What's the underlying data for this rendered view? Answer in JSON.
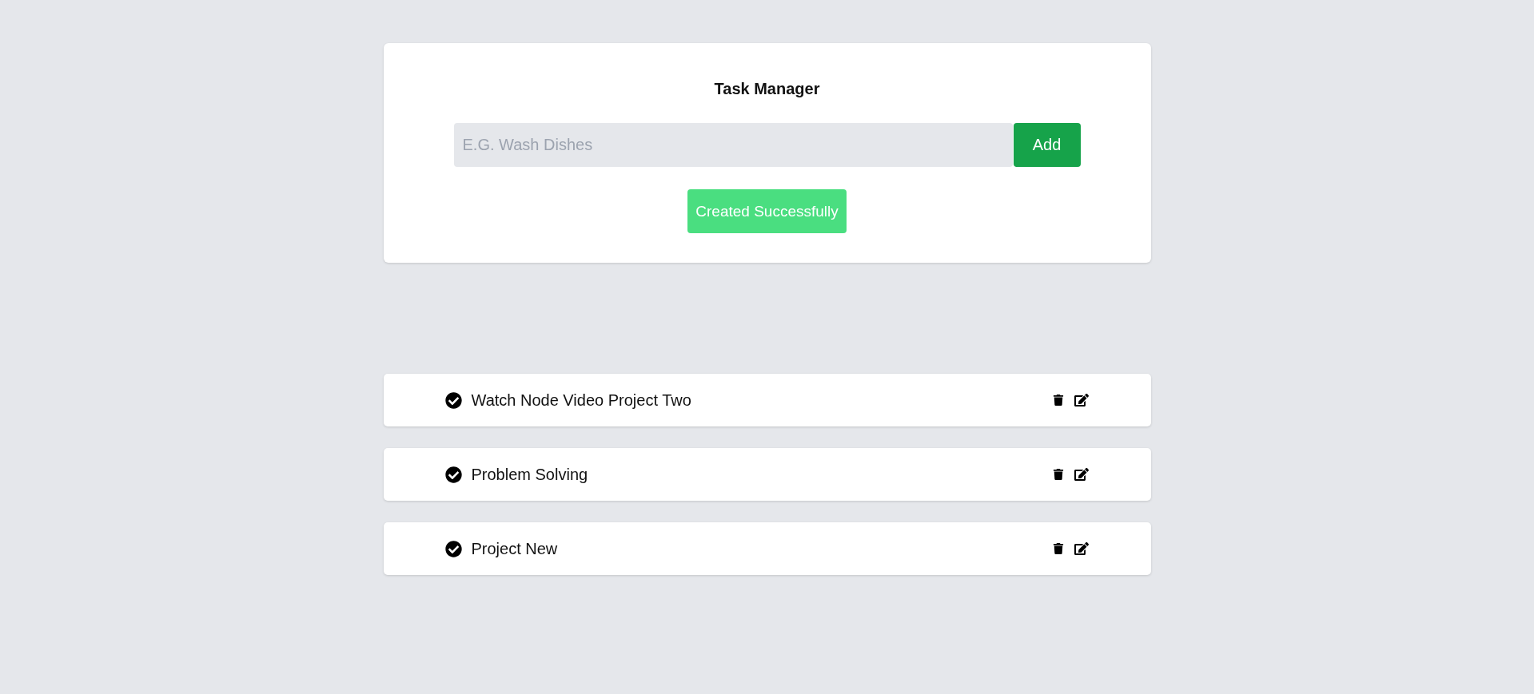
{
  "header": {
    "title": "Task Manager"
  },
  "form": {
    "placeholder": "E.G. Wash Dishes",
    "submit_label": "Add"
  },
  "alert": {
    "message": "Created Successfully"
  },
  "tasks": [
    {
      "name": "Watch Node Video Project Two"
    },
    {
      "name": "Problem Solving"
    },
    {
      "name": "Project New"
    }
  ]
}
